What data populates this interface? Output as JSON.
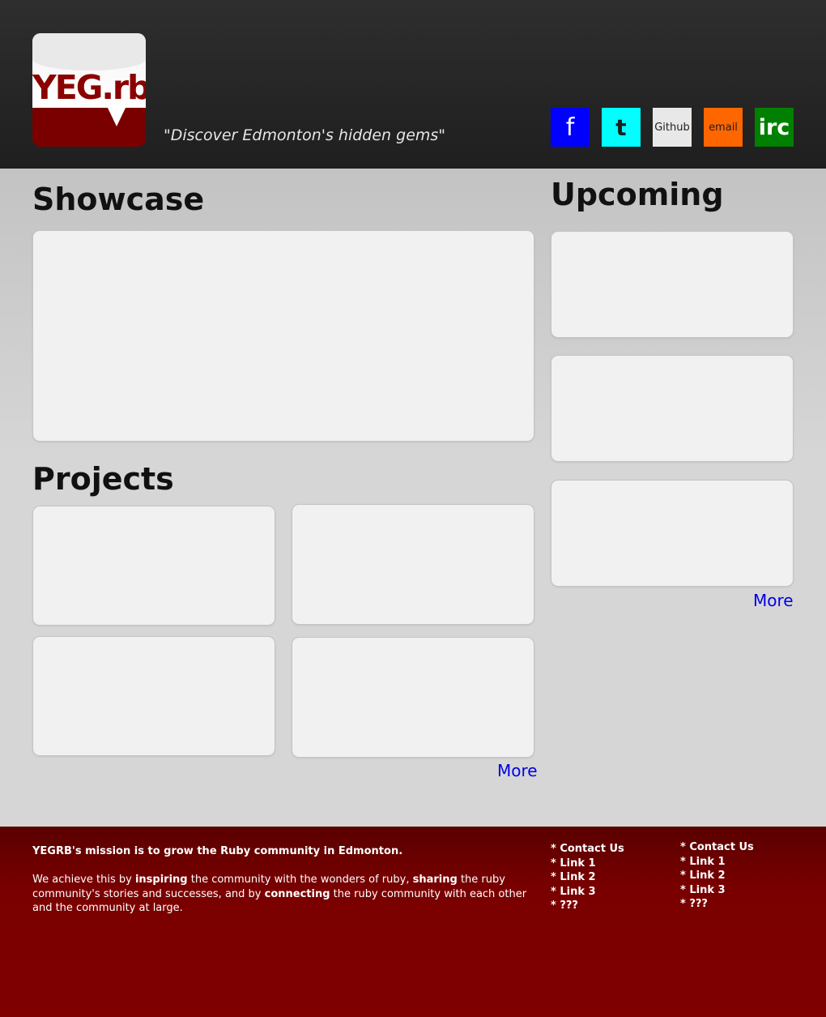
{
  "header": {
    "logo_text": "YEG.rb",
    "tagline": "\"Discover Edmonton's hidden gems\"",
    "social": [
      {
        "label": "f",
        "icon": "facebook-icon",
        "color": "#0000ff"
      },
      {
        "label": "t",
        "icon": "twitter-icon",
        "color": "#00ffff"
      },
      {
        "label": "Github",
        "icon": "github-icon",
        "color": "#e8e8e8"
      },
      {
        "label": "email",
        "icon": "email-icon",
        "color": "#ff6600"
      },
      {
        "label": "irc",
        "icon": "irc-icon",
        "color": "#008000"
      }
    ]
  },
  "showcase": {
    "heading": "Showcase"
  },
  "projects": {
    "heading": "Projects",
    "more_label": "More"
  },
  "upcoming": {
    "heading": "Upcoming",
    "more_label": "More"
  },
  "footer": {
    "mission_title": "YEGRB's mission is to grow the Ruby community in Edmonton.",
    "mission_parts": {
      "p1": "We achieve this by ",
      "b1": "inspiring",
      "p2": " the community with the wonders of ruby, ",
      "b2": "sharing",
      "p3": " the ruby community's stories and successes, and by ",
      "b3": "connecting",
      "p4": " the ruby community with each other and the community at large."
    },
    "links_col1": [
      "* Contact Us",
      "* Link 1",
      "* Link 2",
      "* Link 3",
      "* ???"
    ],
    "links_col2": [
      "* Contact Us",
      "* Link 1",
      "* Link 2",
      "* Link 3",
      "* ???"
    ]
  },
  "colors": {
    "header_bg": "#262626",
    "footer_bg": "#800000",
    "link": "#0000e6"
  }
}
